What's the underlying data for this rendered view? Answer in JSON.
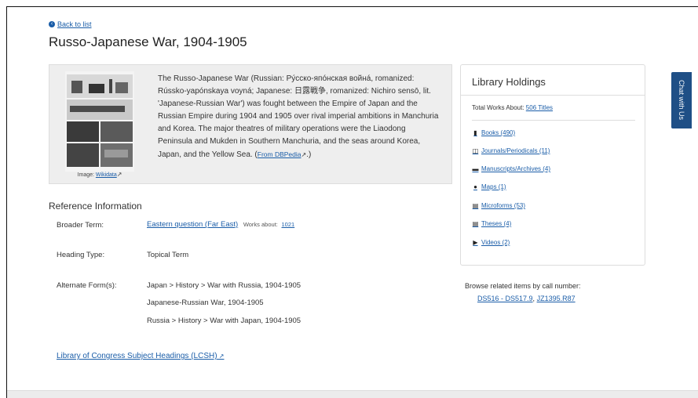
{
  "nav": {
    "back_label": "Back to list"
  },
  "page": {
    "title": "Russo-Japanese War, 1904-1905"
  },
  "abstract": {
    "text": "The Russo-Japanese War (Russian: Ру́сско-япóнская войнá, romanized: Rússko-yapónskaya voyná; Japanese: 日露戦争, romanized: Nichiro sensō, lit. 'Japanese-Russian War') was fought between the Empire of Japan and the Russian Empire during 1904 and 1905 over rival imperial ambitions in Manchuria and Korea. The major theatres of military operations were the Liaodong Peninsula and Mukden in Southern Manchuria, and the seas around Korea, Japan, and the Yellow Sea.",
    "source_link": "From DBPedia",
    "image_caption_prefix": "Image:",
    "image_link": "Wikidata"
  },
  "reference": {
    "heading": "Reference Information",
    "broader_label": "Broader Term:",
    "broader_term": "Eastern question (Far East)",
    "works_about_label": "Works about:",
    "works_about_count": "1021",
    "heading_type_label": "Heading Type:",
    "heading_type": "Topical Term",
    "alternate_label": "Alternate Form(s):",
    "alternate_forms": [
      "Japan > History > War with Russia, 1904-1905",
      "Japanese-Russian War, 1904-1905",
      "Russia > History > War with Japan, 1904-1905"
    ],
    "lcsh_link": "Library of Congress Subject Headings (LCSH)"
  },
  "holdings": {
    "title": "Library Holdings",
    "total_label": "Total Works About:",
    "total_value": "506 Titles",
    "items": [
      {
        "label": "Books (490)",
        "icon": "book-icon"
      },
      {
        "label": "Journals/Periodicals (11)",
        "icon": "journal-icon"
      },
      {
        "label": "Manuscripts/Archives (4)",
        "icon": "archive-icon"
      },
      {
        "label": "Maps (1)",
        "icon": "globe-icon"
      },
      {
        "label": "Microforms (53)",
        "icon": "film-icon"
      },
      {
        "label": "Theses (4)",
        "icon": "document-icon"
      },
      {
        "label": "Videos (2)",
        "icon": "video-icon"
      }
    ]
  },
  "browse": {
    "label": "Browse related items by call number:",
    "link1": "DS516 - DS517.9",
    "separator": ",",
    "link2": "JZ1395.R87"
  },
  "chat": {
    "label": "Chat with Us"
  },
  "colors": {
    "link": "#1a5da8",
    "chat_bg": "#1f4f86",
    "abstract_bg": "#eeeeee"
  }
}
